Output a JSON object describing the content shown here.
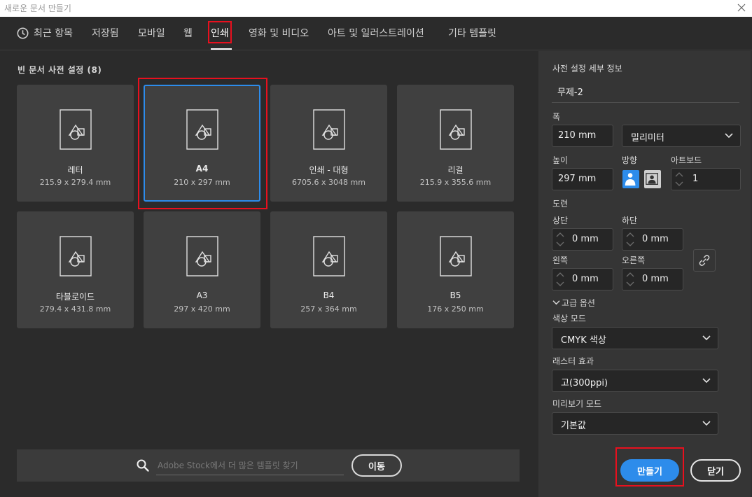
{
  "window": {
    "title": "새로운 문서 만들기"
  },
  "tabs": [
    {
      "label": "최근 항목",
      "icon": "clock-icon"
    },
    {
      "label": "저장됨"
    },
    {
      "label": "모바일"
    },
    {
      "label": "웹"
    },
    {
      "label": "인쇄",
      "active": true
    },
    {
      "label": "영화 및 비디오"
    },
    {
      "label": "아트 및 일러스트레이션"
    },
    {
      "label": "기타 템플릿"
    }
  ],
  "presets": {
    "title": "빈 문서 사전 설정",
    "count": "(8)",
    "items": [
      {
        "name": "레터",
        "size": "215.9 x 279.4 mm"
      },
      {
        "name": "A4",
        "size": "210 x 297 mm",
        "selected": true
      },
      {
        "name": "인쇄 - 대형",
        "size": "6705.6 x 3048 mm"
      },
      {
        "name": "리걸",
        "size": "215.9 x 355.6 mm"
      },
      {
        "name": "타블로이드",
        "size": "279.4 x 431.8 mm"
      },
      {
        "name": "A3",
        "size": "297 x 420 mm"
      },
      {
        "name": "B4",
        "size": "257 x 364 mm"
      },
      {
        "name": "B5",
        "size": "176 x 250 mm"
      }
    ]
  },
  "stock": {
    "placeholder": "Adobe Stock에서 더 많은 템플릿 찾기",
    "go_label": "이동"
  },
  "details": {
    "title": "사전 설정 세부 정보",
    "doc_name": "무제-2",
    "width_label": "폭",
    "width_value": "210 mm",
    "unit": "밀리미터",
    "height_label": "높이",
    "height_value": "297 mm",
    "orientation_label": "방향",
    "artboard_label": "아트보드",
    "artboard_value": "1",
    "bleed_label": "도련",
    "bleed_top_label": "상단",
    "bleed_top": "0 mm",
    "bleed_bottom_label": "하단",
    "bleed_bottom": "0 mm",
    "bleed_left_label": "왼쪽",
    "bleed_left": "0 mm",
    "bleed_right_label": "오른쪽",
    "bleed_right": "0 mm",
    "advanced_label": "고급 옵션",
    "color_mode_label": "색상 모드",
    "color_mode": "CMYK 색상",
    "raster_label": "래스터 효과",
    "raster": "고(300ppi)",
    "preview_label": "미리보기 모드",
    "preview": "기본값"
  },
  "actions": {
    "create_label": "만들기",
    "close_label": "닫기"
  },
  "colors": {
    "accent": "#2d8ceb",
    "highlight": "#e8101e",
    "card": "#404040",
    "panel": "#353535"
  }
}
